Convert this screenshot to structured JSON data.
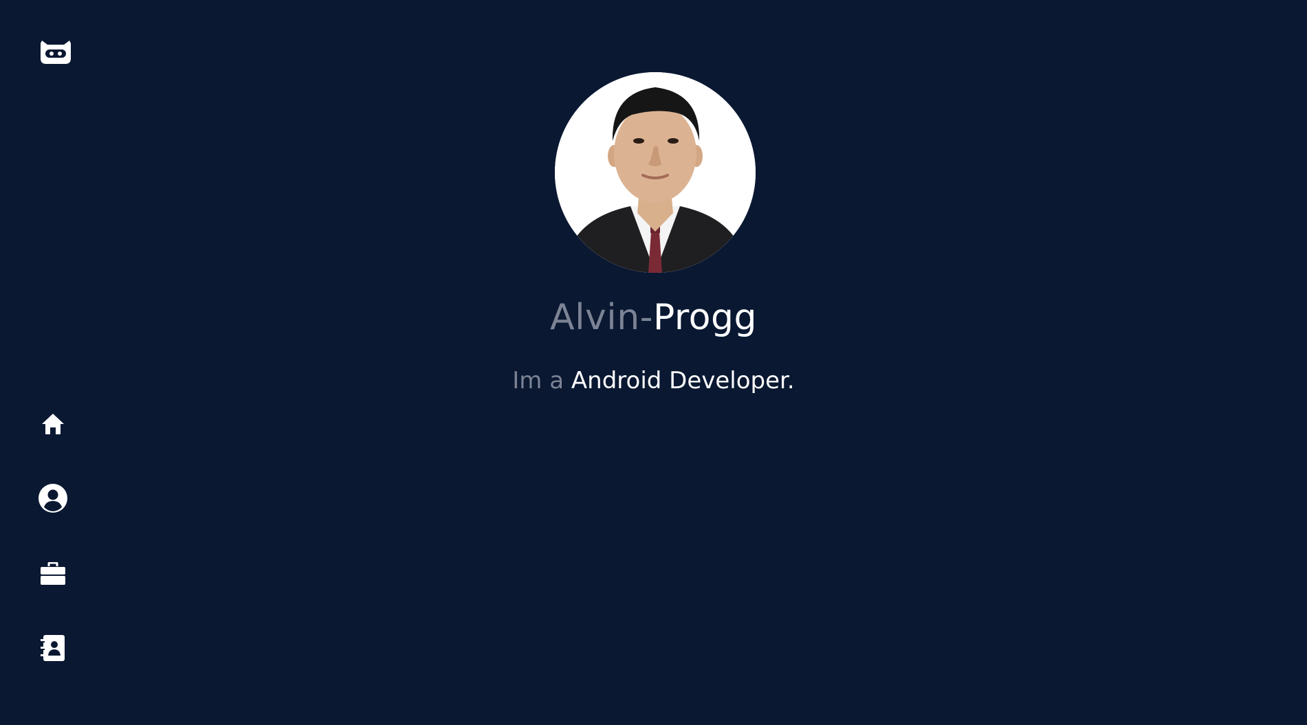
{
  "brand": {
    "logo_icon": "robot-face-icon"
  },
  "sidebar": {
    "items": [
      {
        "icon": "home-icon",
        "label": "Home"
      },
      {
        "icon": "user-circle-icon",
        "label": "About"
      },
      {
        "icon": "briefcase-icon",
        "label": "Portfolio"
      },
      {
        "icon": "address-book-icon",
        "label": "Contact"
      }
    ]
  },
  "hero": {
    "avatar_alt": "profile photo",
    "name_first": "Alvin-",
    "name_last": "Progg",
    "tagline_prefix": "Im a ",
    "tagline_role": "Android Developer."
  },
  "colors": {
    "background": "#0a1832",
    "muted_text": "#7c8394",
    "primary_text": "#ffffff"
  }
}
